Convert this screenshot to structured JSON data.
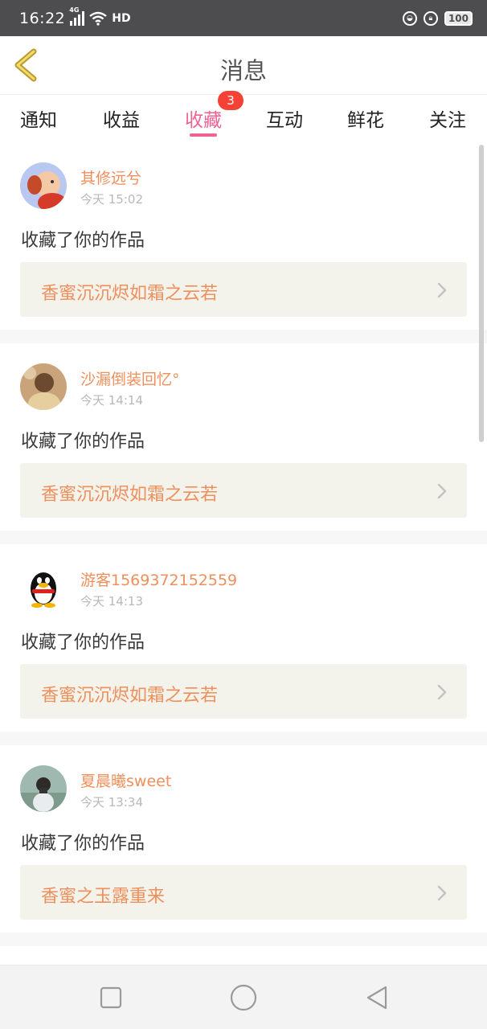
{
  "status_bar": {
    "time": "16:22",
    "network": "4G",
    "hd": "HD",
    "battery": "100"
  },
  "header": {
    "title": "消息",
    "back_icon": "chevron-left-icon"
  },
  "tabs": [
    {
      "label": "通知"
    },
    {
      "label": "收益"
    },
    {
      "label": "收藏",
      "active": true,
      "badge": "3"
    },
    {
      "label": "互动"
    },
    {
      "label": "鲜花"
    },
    {
      "label": "关注"
    }
  ],
  "accent_color": "#f06292",
  "name_color": "#ef8f5b",
  "messages": [
    {
      "username": "其修远兮",
      "time": "今天 15:02",
      "action": "收藏了你的作品",
      "work_title": "香蜜沉沉烬如霜之云若"
    },
    {
      "username": "沙漏倒装回忆°",
      "time": "今天 14:14",
      "action": "收藏了你的作品",
      "work_title": "香蜜沉沉烬如霜之云若"
    },
    {
      "username": "游客1569372152559",
      "time": "今天 14:13",
      "action": "收藏了你的作品",
      "work_title": "香蜜沉沉烬如霜之云若"
    },
    {
      "username": "夏晨曦sweet",
      "time": "今天 13:34",
      "action": "收藏了你的作品",
      "work_title": "香蜜之玉露重来"
    }
  ],
  "navbar": {
    "recents_icon": "square-icon",
    "home_icon": "circle-icon",
    "back_icon": "triangle-back-icon"
  }
}
